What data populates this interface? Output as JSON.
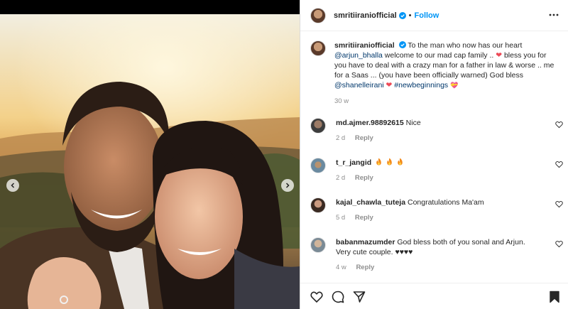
{
  "header": {
    "username": "smritiiraniofficial",
    "follow_label": "Follow",
    "dot": "•"
  },
  "caption": {
    "username": "smritiiraniofficial",
    "text_1": "To the man who now has our heart",
    "mention_1": "@arjun_bhalla",
    "text_2": "welcome to our mad cap family ..",
    "text_3": "bless you for you have to deal with a crazy man for a father in law & worse .. me for a Saas ... (you have been officially warned) God bless",
    "mention_2": "@shanelleirani",
    "hashtag": "#newbeginnings",
    "time": "30 w"
  },
  "comments": [
    {
      "username": "md.ajmer.98892615",
      "text": "Nice",
      "time": "2 d",
      "reply_label": "Reply"
    },
    {
      "username": "t_r_jangid",
      "text": "",
      "time": "2 d",
      "reply_label": "Reply"
    },
    {
      "username": "kajal_chawla_tuteja",
      "text": "Congratulations Ma'am",
      "time": "5 d",
      "reply_label": "Reply"
    },
    {
      "username": "babanmazumder",
      "text": "God bless both of you sonal and Arjun. Very cute couple. ♥♥♥♥",
      "time": "4 w",
      "reply_label": "Reply"
    }
  ],
  "icons": {
    "verified": "verified-badge-icon",
    "more": "more-options-icon",
    "like": "heart-icon",
    "comment": "comment-icon",
    "share": "share-icon",
    "save": "bookmark-icon",
    "prev": "chevron-left-icon",
    "next": "chevron-right-icon"
  },
  "colors": {
    "accent": "#0095f6",
    "heart": "#ed4956",
    "muted": "#8e8e8e"
  }
}
